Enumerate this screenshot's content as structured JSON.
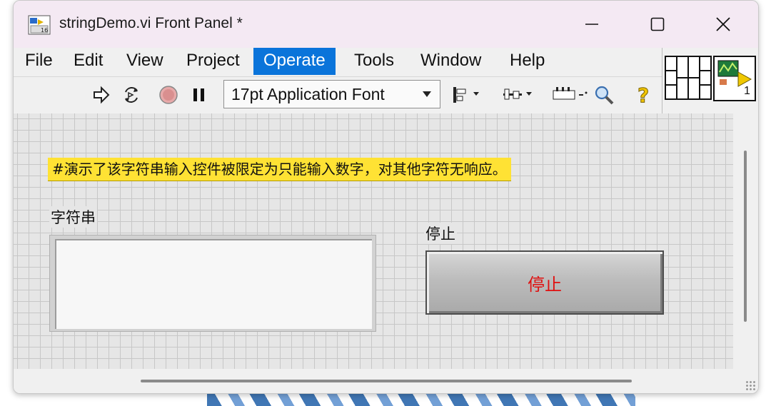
{
  "window": {
    "title": "stringDemo.vi Front Panel *"
  },
  "menu": [
    {
      "label": "File"
    },
    {
      "label": "Edit"
    },
    {
      "label": "View"
    },
    {
      "label": "Project"
    },
    {
      "label": "Operate",
      "active": true
    },
    {
      "label": "Tools"
    },
    {
      "label": "Window"
    },
    {
      "label": "Help"
    }
  ],
  "toolbar": {
    "font_select_value": "17pt Application Font",
    "connector_pane_number": "1"
  },
  "panel": {
    "note_text": "#演示了该字符串输入控件被限定为只能输入数字，对其他字符无响应。",
    "string_label": "字符串",
    "string_value": "",
    "stop_label": "停止",
    "stop_button_text": "停止"
  },
  "colors": {
    "accent": "#0a74da",
    "note_bg": "#ffe234",
    "stop_text": "#e01010",
    "titlebar_bg": "#f4e9f3"
  }
}
